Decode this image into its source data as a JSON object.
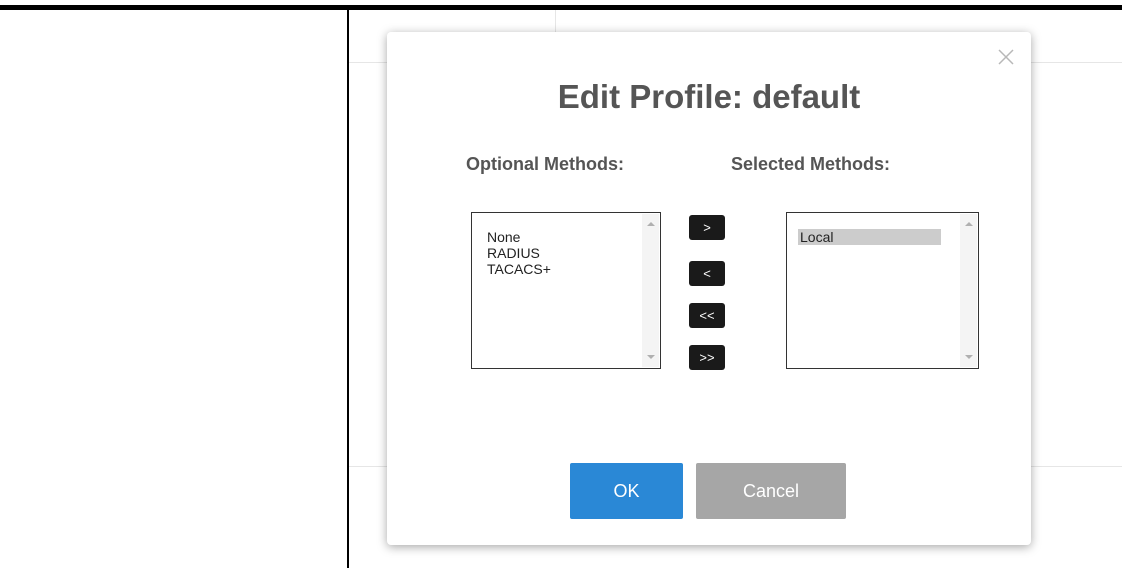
{
  "dialog": {
    "title": "Edit Profile: default",
    "close_icon": "close-icon"
  },
  "optional": {
    "label": "Optional Methods:",
    "items": [
      "None",
      "RADIUS",
      "TACACS+"
    ]
  },
  "selected": {
    "label": "Selected Methods:",
    "items": [
      "Local"
    ]
  },
  "move_buttons": {
    "add": ">",
    "remove": "<",
    "remove_all": "<<",
    "add_all": ">>"
  },
  "actions": {
    "ok": "OK",
    "cancel": "Cancel"
  },
  "colors": {
    "primary": "#2a88d6",
    "secondary": "#a6a6a6",
    "move_button": "#1a1a1a",
    "title_text": "#555555"
  }
}
